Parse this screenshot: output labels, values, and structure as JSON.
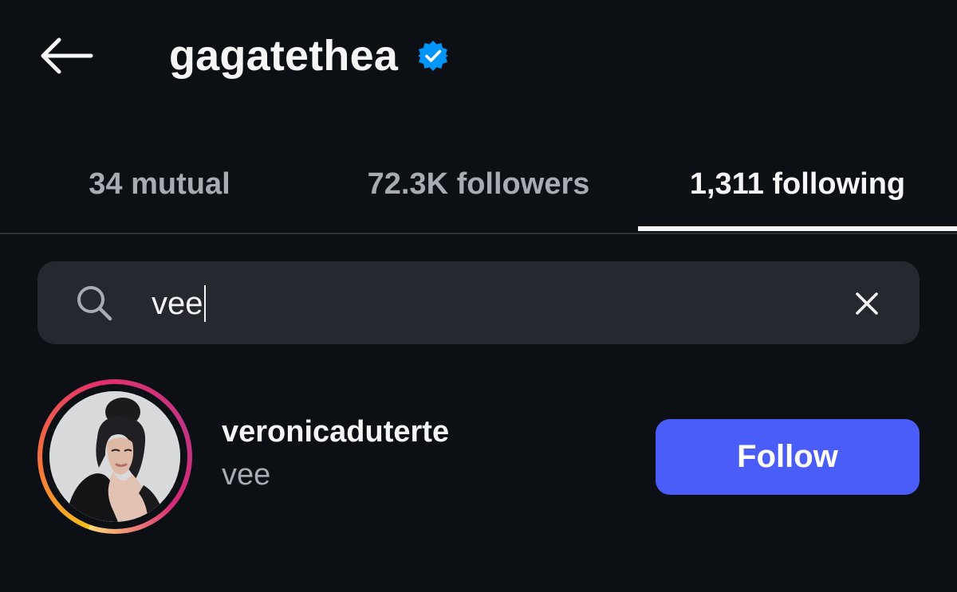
{
  "header": {
    "title": "gagatethea",
    "back_icon": "arrow-left-icon",
    "verified_icon": "verified-badge-icon",
    "verified_color": "#0095f6"
  },
  "tabs": [
    {
      "label": "34 mutual",
      "active": false
    },
    {
      "label": "72.3K followers",
      "active": false
    },
    {
      "label": "1,311 following",
      "active": true
    }
  ],
  "search": {
    "value": "vee",
    "icon": "search-icon",
    "clear_icon": "close-icon"
  },
  "results": [
    {
      "username": "veronicaduterte",
      "full_name": "vee",
      "has_story_ring": true,
      "button_label": "Follow"
    }
  ],
  "colors": {
    "background": "#0c0f14",
    "search_bg": "#25282e",
    "accent": "#4a5df9",
    "muted_text": "#a8abb2"
  }
}
